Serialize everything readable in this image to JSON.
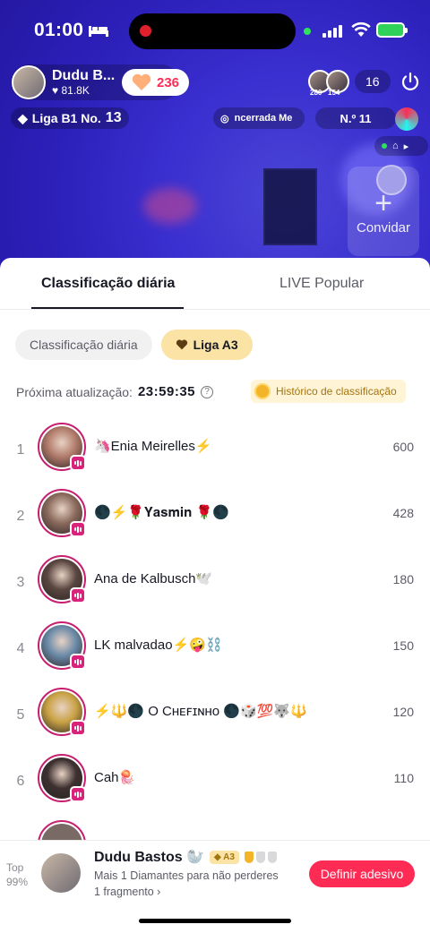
{
  "status_bar": {
    "time": "01:00",
    "sleep_icon": "bed-icon",
    "signal_icon": "cellular-signal-icon",
    "wifi_icon": "wifi-icon",
    "battery_icon": "battery-charging-icon"
  },
  "live_header": {
    "host_name": "Dudu B...",
    "host_likes": "81.8K",
    "gift_count": "236",
    "viewer_counts": [
      "280",
      "154"
    ],
    "viewer_total": "16",
    "league": "Liga B1 No.",
    "league_number": "13",
    "ticker": "ncerrada   Me",
    "rank_label": "N.º 11",
    "invite_label": "Convidar"
  },
  "sheet": {
    "tabs": [
      {
        "label": "Classificação diária"
      },
      {
        "label": "LIVE Popular"
      }
    ],
    "chips": [
      {
        "label": "Classificação diária"
      },
      {
        "label": "Liga A3"
      }
    ],
    "update_label": "Próxima atualização:",
    "update_time": "23:59:35",
    "history_label": "Histórico de classificação"
  },
  "ranking": [
    {
      "rank": "1",
      "name": "🦄Enia Meirelles⚡",
      "score": "600",
      "color": "#b07a6a"
    },
    {
      "rank": "2",
      "name": "🌑⚡🌹𝐘𝐚𝐬𝐦𝐢𝐧 🌹🌑",
      "score": "428",
      "color": "#8a6a5c"
    },
    {
      "rank": "3",
      "name": "Ana de Kalbusch🕊️",
      "score": "180",
      "color": "#5a4640"
    },
    {
      "rank": "4",
      "name": "LK malvadao⚡🤪⛓️",
      "score": "150",
      "color": "#6a8aa8"
    },
    {
      "rank": "5",
      "name": "⚡🔱🌑 O Cʜᴇꜰɪɴʜᴏ 🌑🎲💯🐺🔱",
      "score": "120",
      "color": "#c9a244"
    },
    {
      "rank": "6",
      "name": "Cah🪼",
      "score": "110",
      "color": "#3d3030"
    }
  ],
  "footer": {
    "top_label_1": "Top",
    "top_label_2": "99%",
    "name": "Dudu Bastos 🦭",
    "league_badge": "A3",
    "message": "Mais 1 Diamantes para não perderes",
    "fragment": "1 fragmento ›",
    "cta_label": "Definir adesivo"
  }
}
